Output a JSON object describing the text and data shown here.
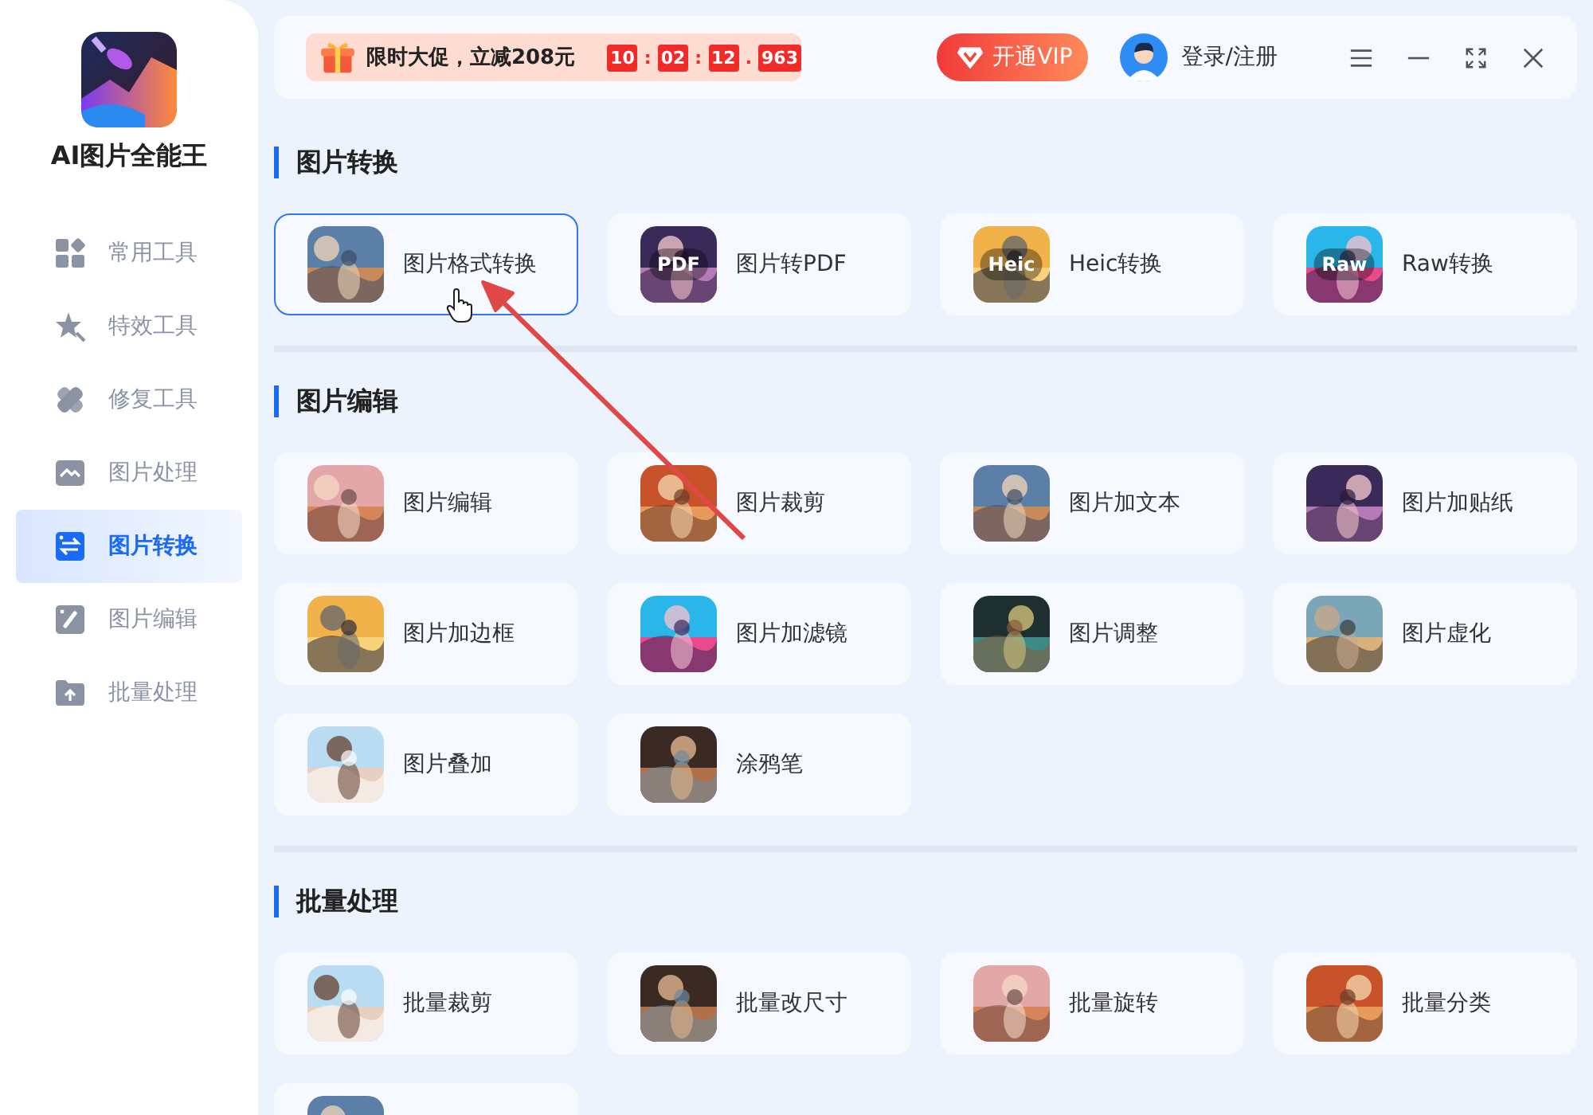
{
  "app": {
    "name": "AI图片全能王"
  },
  "sidebar": {
    "items": [
      {
        "label": "常用工具",
        "selected": false
      },
      {
        "label": "特效工具",
        "selected": false
      },
      {
        "label": "修复工具",
        "selected": false
      },
      {
        "label": "图片处理",
        "selected": false
      },
      {
        "label": "图片转换",
        "selected": true
      },
      {
        "label": "图片编辑",
        "selected": false
      },
      {
        "label": "批量处理",
        "selected": false
      }
    ]
  },
  "topbar": {
    "promo": {
      "text": "限时大促，立减208元",
      "countdown": [
        {
          "kind": "digits",
          "text": "10"
        },
        {
          "kind": "sep",
          "text": ":"
        },
        {
          "kind": "digits",
          "text": "02"
        },
        {
          "kind": "sep",
          "text": ":"
        },
        {
          "kind": "digits",
          "text": "12"
        },
        {
          "kind": "sep",
          "text": "."
        },
        {
          "kind": "digits",
          "text": "963"
        }
      ]
    },
    "vip_button": "开通VIP",
    "login": "登录/注册"
  },
  "sections": [
    {
      "title": "图片转换",
      "tiles": [
        {
          "label": "图片格式转换",
          "selected": true
        },
        {
          "label": "图片转PDF",
          "badge": "PDF",
          "selected": false
        },
        {
          "label": "Heic转换",
          "badge": "Heic",
          "selected": false
        },
        {
          "label": "Raw转换",
          "badge": "Raw",
          "selected": false
        }
      ]
    },
    {
      "title": "图片编辑",
      "tiles": [
        {
          "label": "图片编辑",
          "selected": false
        },
        {
          "label": "图片裁剪",
          "selected": false
        },
        {
          "label": "图片加文本",
          "selected": false
        },
        {
          "label": "图片加贴纸",
          "selected": false
        },
        {
          "label": "图片加边框",
          "selected": false
        },
        {
          "label": "图片加滤镜",
          "selected": false
        },
        {
          "label": "图片调整",
          "selected": false
        },
        {
          "label": "图片虚化",
          "selected": false
        },
        {
          "label": "图片叠加",
          "selected": false
        },
        {
          "label": "涂鸦笔",
          "selected": false
        }
      ]
    },
    {
      "title": "批量处理",
      "tiles": [
        {
          "label": "批量裁剪",
          "selected": false
        },
        {
          "label": "批量改尺寸",
          "selected": false
        },
        {
          "label": "批量旋转",
          "selected": false
        },
        {
          "label": "批量分类",
          "selected": false
        },
        {
          "selected": false
        }
      ]
    }
  ]
}
